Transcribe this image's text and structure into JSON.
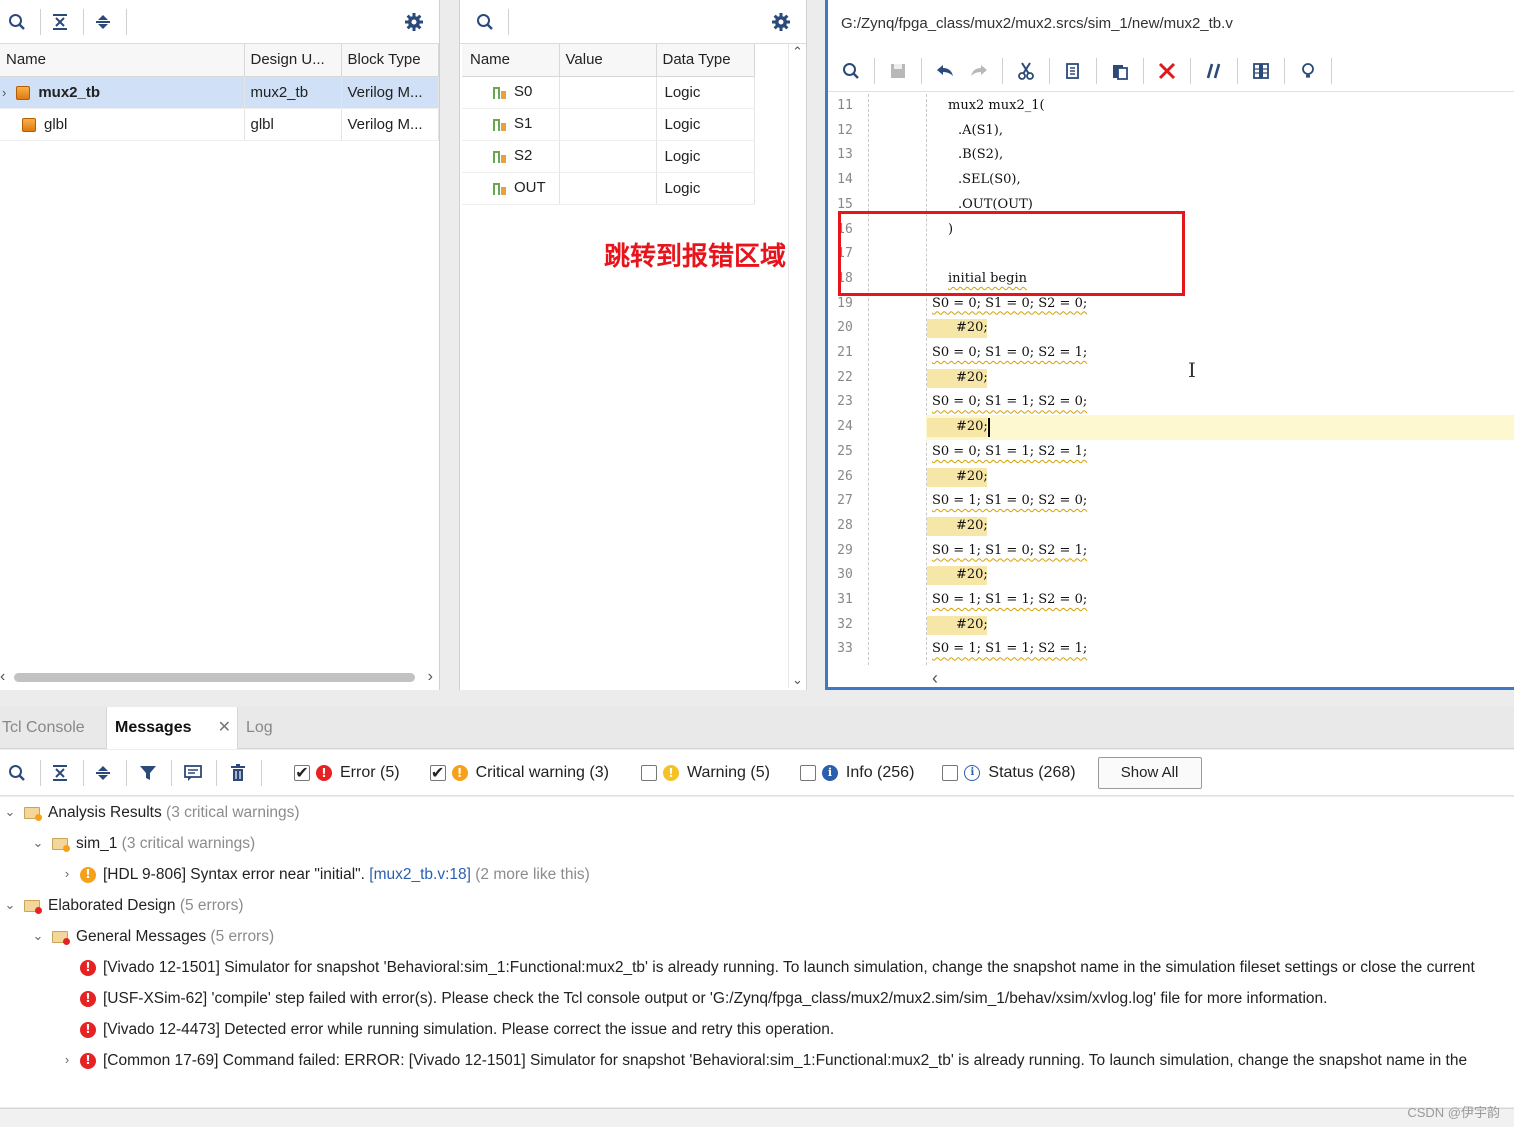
{
  "scope_panel": {
    "columns": [
      "Name",
      "Design U...",
      "Block Type"
    ],
    "rows": [
      {
        "name": "mux2_tb",
        "design_unit": "mux2_tb",
        "block_type": "Verilog M...",
        "selected": true
      },
      {
        "name": "glbl",
        "design_unit": "glbl",
        "block_type": "Verilog M...",
        "selected": false
      }
    ]
  },
  "objects_panel": {
    "columns": [
      "Name",
      "Value",
      "Data Type"
    ],
    "rows": [
      {
        "name": "S0",
        "value": "",
        "type": "Logic"
      },
      {
        "name": "S1",
        "value": "",
        "type": "Logic"
      },
      {
        "name": "S2",
        "value": "",
        "type": "Logic"
      },
      {
        "name": "OUT",
        "value": "",
        "type": "Logic"
      }
    ],
    "annotation": "跳转到报错区域",
    "annotation_color": "#e8141c"
  },
  "editor": {
    "path": "G:/Zynq/fpga_class/mux2/mux2.srcs/sim_1/new/mux2_tb.v",
    "lines": [
      {
        "n": "11",
        "text": "mux2 mux2_1(",
        "indent": 2
      },
      {
        "n": "12",
        "text": ".A(S1),",
        "indent": 3
      },
      {
        "n": "13",
        "text": ".B(S2),",
        "indent": 3
      },
      {
        "n": "14",
        "text": ".SEL(S0),",
        "indent": 3
      },
      {
        "n": "15",
        "text": ".OUT(OUT)",
        "indent": 3
      },
      {
        "n": "16",
        "text": ")",
        "indent": 2
      },
      {
        "n": "17",
        "text": "",
        "indent": 2
      },
      {
        "n": "18",
        "text": "initial begin",
        "indent": 2
      },
      {
        "n": "19",
        "text": "S0 = 0; S1 = 0; S2 = 0;",
        "indent": 1
      },
      {
        "n": "20",
        "text": "#20;",
        "indent": 1
      },
      {
        "n": "21",
        "text": "S0 = 0; S1 = 0; S2 = 1;",
        "indent": 1
      },
      {
        "n": "22",
        "text": "#20;",
        "indent": 1
      },
      {
        "n": "23",
        "text": "S0 = 0; S1 = 1; S2 = 0;",
        "indent": 1
      },
      {
        "n": "24",
        "text": "#20;",
        "indent": 1
      },
      {
        "n": "25",
        "text": "S0 = 0; S1 = 1; S2 = 1;",
        "indent": 1
      },
      {
        "n": "26",
        "text": "#20;",
        "indent": 1
      },
      {
        "n": "27",
        "text": "S0 = 1; S1 = 0; S2 = 0;",
        "indent": 1
      },
      {
        "n": "28",
        "text": "#20;",
        "indent": 1
      },
      {
        "n": "29",
        "text": "S0 = 1; S1 = 0; S2 = 1;",
        "indent": 1
      },
      {
        "n": "30",
        "text": "#20;",
        "indent": 1
      },
      {
        "n": "31",
        "text": "S0 = 1; S1 = 1; S2 = 0;",
        "indent": 1
      },
      {
        "n": "32",
        "text": "#20;",
        "indent": 1
      },
      {
        "n": "33",
        "text": "S0 = 1; S1 = 1; S2 = 1;",
        "indent": 1
      }
    ],
    "current_line": "24"
  },
  "bottom_tabs": [
    "Tcl Console",
    "Messages",
    "Log"
  ],
  "filters": [
    {
      "label": "Error (5)",
      "checked": true,
      "kind": "error"
    },
    {
      "label": "Critical warning (3)",
      "checked": true,
      "kind": "critical"
    },
    {
      "label": "Warning (5)",
      "checked": false,
      "kind": "warning"
    },
    {
      "label": "Info (256)",
      "checked": false,
      "kind": "info"
    },
    {
      "label": "Status (268)",
      "checked": false,
      "kind": "status"
    }
  ],
  "show_all_label": "Show All",
  "messages": {
    "analysis": {
      "title": "Analysis Results",
      "count": "(3 critical warnings)"
    },
    "sim": {
      "title": "sim_1",
      "count": "(3 critical warnings)"
    },
    "sim_msg": {
      "text": "[HDL 9-806] Syntax error near \"initial\". ",
      "link": "[mux2_tb.v:18]",
      "more": " (2 more like this)"
    },
    "elab": {
      "title": "Elaborated Design",
      "count": "(5 errors)"
    },
    "general": {
      "title": "General Messages",
      "count": "(5 errors)"
    },
    "errors": [
      "[Vivado 12-1501] Simulator for snapshot 'Behavioral:sim_1:Functional:mux2_tb' is already running. To launch simulation, change the snapshot name in the simulation fileset settings or close the current",
      "[USF-XSim-62] 'compile' step failed with error(s). Please check the Tcl console output or 'G:/Zynq/fpga_class/mux2/mux2.sim/sim_1/behav/xsim/xvlog.log' file for more information.",
      "[Vivado 12-4473] Detected error while running simulation. Please correct the issue and retry this operation.",
      "[Common 17-69] Command failed: ERROR: [Vivado 12-1501] Simulator for snapshot 'Behavioral:sim_1:Functional:mux2_tb' is already running. To launch simulation, change the snapshot name in the"
    ]
  },
  "watermark": "CSDN @伊宇韵"
}
